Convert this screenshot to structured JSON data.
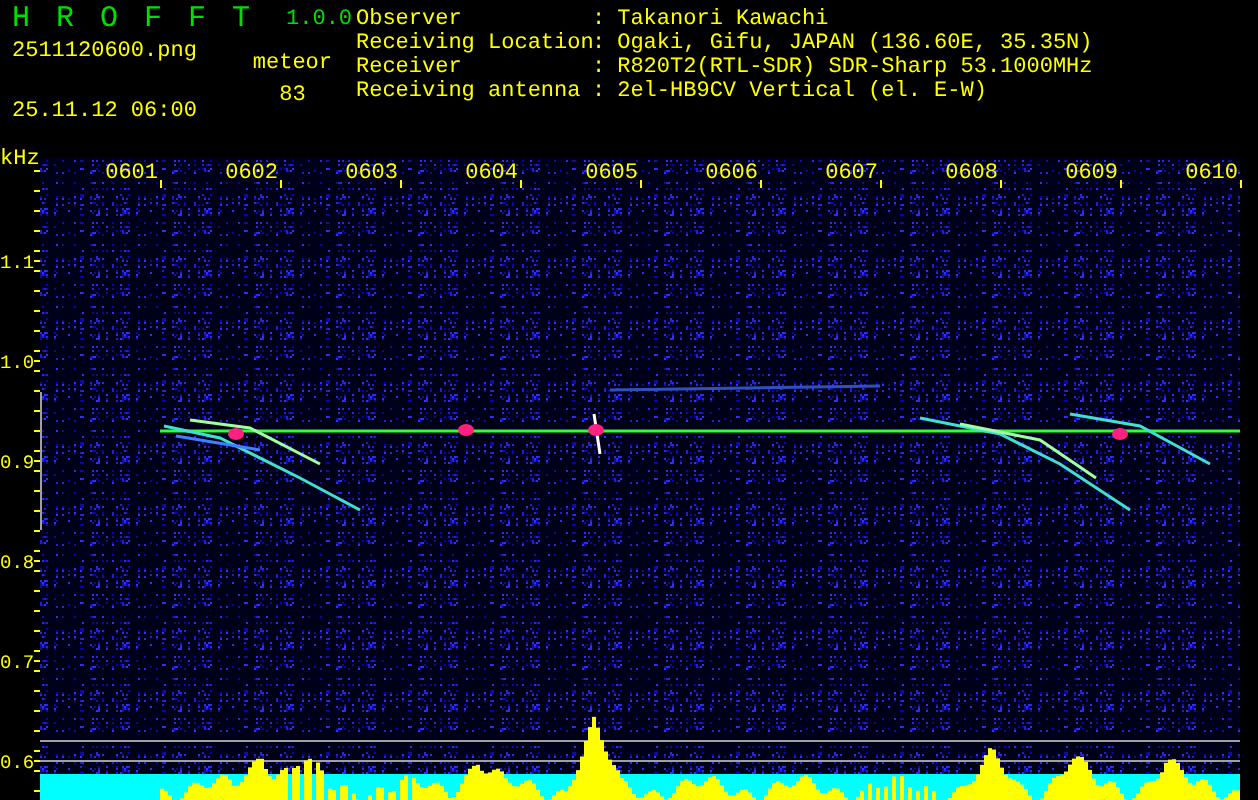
{
  "header": {
    "app_title": "H R O F F T",
    "version": "1.0.0",
    "file_name": "2511120600.png",
    "timestamp": "25.11.12 06:00",
    "meteor_label": "meteor",
    "meteor_count": "83"
  },
  "station_info": [
    {
      "label": "Observer",
      "separator": ":",
      "value": "Takanori Kawachi"
    },
    {
      "label": "Receiving Location",
      "separator": ":",
      "value": "Ogaki, Gifu, JAPAN (136.60E, 35.35N)"
    },
    {
      "label": "Receiver",
      "separator": ":",
      "value": "R820T2(RTL-SDR) SDR-Sharp 53.1000MHz"
    },
    {
      "label": "Receiving antenna",
      "separator": ":",
      "value": "2el-HB9CV Vertical (el. E-W)"
    }
  ],
  "spectrogram": {
    "y_unit": "kHz",
    "y_labels": [
      "1.1",
      "1.0",
      "0.9",
      "0.8",
      "0.7",
      "0.6"
    ],
    "x_labels": [
      "0601",
      "0602",
      "0603",
      "0604",
      "0605",
      "0606",
      "0607",
      "0608",
      "0609",
      "0610"
    ]
  }
}
